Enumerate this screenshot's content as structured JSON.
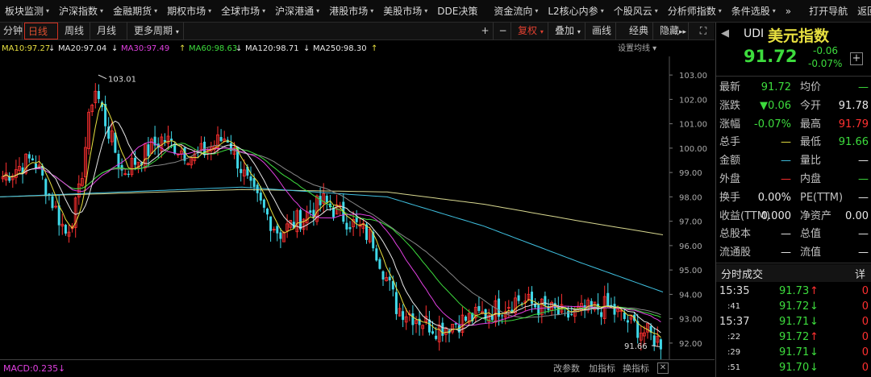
{
  "menu": [
    "板块监测",
    "沪深指数",
    "金融期货",
    "期权市场",
    "全球市场",
    "沪深港通",
    "港股市场",
    "美股市场",
    "DDE决策",
    "资金流向",
    "L2核心内参",
    "个股风云",
    "分析师指数",
    "条件选股",
    "»",
    "打开导航",
    "返回"
  ],
  "toolbar": {
    "periods": [
      "分钟",
      "日线",
      "周线",
      "月线",
      "更多周期"
    ],
    "active": "日线",
    "plus": "+",
    "minus": "−",
    "fuquan": "复权",
    "add": "叠加",
    "drawline": "画线",
    "classic": "经典",
    "hide": "隐藏",
    "scroll": "▸▸"
  },
  "ma_labels": [
    {
      "text": "MA10:97.27",
      "color": "#e8e040"
    },
    {
      "text": "MA20:97.04",
      "color": "#e8e8e8"
    },
    {
      "text": "MA30:97.49",
      "color": "#e040e0"
    },
    {
      "text": "MA60:98.63",
      "color": "#3ddc3d"
    },
    {
      "text": "MA120:98.71",
      "color": "#e8e8e8"
    },
    {
      "text": "MA250:98.30",
      "color": "#e8e8e8"
    }
  ],
  "ma_arrows": [
    "↓",
    "↓",
    "↑",
    "↓",
    "↓",
    "↑"
  ],
  "ma_setting": "设置均线",
  "chart_data": {
    "type": "candlestick",
    "y_ticks": [
      "103.00",
      "102.00",
      "101.00",
      "100.00",
      "99.00",
      "98.00",
      "97.00",
      "96.00",
      "95.00",
      "94.00",
      "93.00",
      "92.00"
    ],
    "ylim": [
      91.6,
      103.5
    ],
    "high_label": "103.01",
    "low_label": "91.66",
    "series": [
      {
        "name": "MA10",
        "color": "#e8e040"
      },
      {
        "name": "MA20",
        "color": "#e8e8e8"
      },
      {
        "name": "MA30",
        "color": "#e040e0"
      },
      {
        "name": "MA60",
        "color": "#3ddc3d"
      },
      {
        "name": "MA120",
        "color": "#3fc0e0"
      },
      {
        "name": "MA250",
        "color": "#d8d890"
      }
    ],
    "ma120_anchor": [
      [
        0,
        98.0
      ],
      [
        300,
        98.4
      ],
      [
        480,
        98.0
      ],
      [
        600,
        96.8
      ],
      [
        720,
        95.3
      ],
      [
        830,
        94.0
      ]
    ],
    "ma250_anchor": [
      [
        0,
        98.0
      ],
      [
        300,
        98.3
      ],
      [
        480,
        98.2
      ],
      [
        600,
        97.7
      ],
      [
        720,
        97.0
      ],
      [
        830,
        96.4
      ]
    ],
    "ma60_anchor": [
      [
        0,
        98.6
      ],
      [
        120,
        99.2
      ],
      [
        300,
        99.6
      ],
      [
        360,
        98.8
      ],
      [
        480,
        96.5
      ],
      [
        560,
        94.8
      ],
      [
        700,
        93.6
      ],
      [
        830,
        92.4
      ]
    ],
    "ma20_anchor": [
      [
        0,
        98.4
      ],
      [
        60,
        98.2
      ],
      [
        200,
        99.8
      ],
      [
        300,
        99.4
      ],
      [
        350,
        97.2
      ],
      [
        470,
        95.0
      ],
      [
        530,
        93.8
      ],
      [
        700,
        93.6
      ],
      [
        830,
        93.2
      ]
    ],
    "close_anchor": [
      [
        0,
        98.8
      ],
      [
        40,
        99.6
      ],
      [
        80,
        96.5
      ],
      [
        95,
        97.8
      ],
      [
        115,
        102.6
      ],
      [
        130,
        101.0
      ],
      [
        150,
        99.0
      ],
      [
        200,
        100.4
      ],
      [
        240,
        99.6
      ],
      [
        280,
        100.5
      ],
      [
        310,
        98.2
      ],
      [
        345,
        96.5
      ],
      [
        400,
        97.8
      ],
      [
        460,
        96.3
      ],
      [
        490,
        93.5
      ],
      [
        540,
        92.6
      ],
      [
        600,
        93.2
      ],
      [
        640,
        93.8
      ],
      [
        700,
        93.1
      ],
      [
        750,
        93.5
      ],
      [
        790,
        92.6
      ],
      [
        825,
        91.9
      ]
    ]
  },
  "macd": "MACD:0.235",
  "bottom_btns": [
    "改参数",
    "加指标",
    "换指标"
  ],
  "panel": {
    "code": "UDI",
    "name": "美元指数",
    "price": "91.72",
    "change": "-0.06",
    "pct": "-0.07%",
    "rows": [
      [
        {
          "k": "最新",
          "v": "91.72",
          "c": "green"
        },
        {
          "k": "均价",
          "v": "—",
          "c": "green"
        }
      ],
      [
        {
          "k": "涨跌",
          "v": "▼0.06",
          "c": "green"
        },
        {
          "k": "今开",
          "v": "91.78",
          "c": "white"
        }
      ],
      [
        {
          "k": "涨幅",
          "v": "-0.07%",
          "c": "green"
        },
        {
          "k": "最高",
          "v": "91.79",
          "c": "red2"
        }
      ],
      [
        {
          "k": "总手",
          "v": "—",
          "c": "yellow"
        },
        {
          "k": "最低",
          "v": "91.66",
          "c": "green"
        }
      ],
      [
        {
          "k": "金额",
          "v": "—",
          "c": "cyan"
        },
        {
          "k": "量比",
          "v": "—",
          "c": "white"
        }
      ],
      [
        {
          "k": "外盘",
          "v": "—",
          "c": "red2"
        },
        {
          "k": "内盘",
          "v": "—",
          "c": "green"
        }
      ],
      [
        {
          "k": "换手",
          "v": "0.00%",
          "c": "white"
        },
        {
          "k": "PE(TTM)",
          "v": "—",
          "c": "white"
        }
      ],
      [
        {
          "k": "收益(TTM)",
          "v": "0.000",
          "c": "white"
        },
        {
          "k": "净资产",
          "v": "0.00",
          "c": "white"
        }
      ],
      [
        {
          "k": "总股本",
          "v": "—",
          "c": "white"
        },
        {
          "k": "总值",
          "v": "—",
          "c": "white"
        }
      ],
      [
        {
          "k": "流通股",
          "v": "—",
          "c": "white"
        },
        {
          "k": "流值",
          "v": "—",
          "c": "white"
        }
      ]
    ],
    "ticks_title": "分时成交",
    "ticks_detail": "详",
    "ticks": [
      {
        "t": "15:35",
        "p": "91.73",
        "d": "↑",
        "dc": "red2",
        "v": "0",
        "big": true
      },
      {
        "t": ":41",
        "p": "91.72",
        "d": "↓",
        "dc": "green",
        "v": "0",
        "big": false
      },
      {
        "t": "15:37",
        "p": "91.71",
        "d": "↓",
        "dc": "green",
        "v": "0",
        "big": true
      },
      {
        "t": ":22",
        "p": "91.72",
        "d": "↑",
        "dc": "red2",
        "v": "0",
        "big": false
      },
      {
        "t": ":29",
        "p": "91.71",
        "d": "↓",
        "dc": "green",
        "v": "0",
        "big": false
      },
      {
        "t": ":51",
        "p": "91.70",
        "d": "↓",
        "dc": "green",
        "v": "0",
        "big": false
      }
    ]
  }
}
